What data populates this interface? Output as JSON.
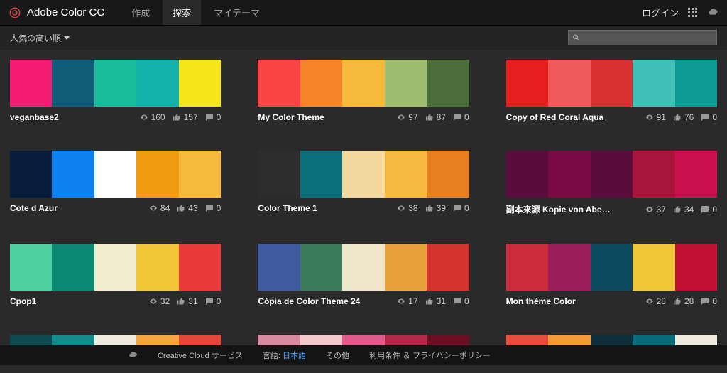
{
  "header": {
    "app_title": "Adobe Color CC",
    "tabs": [
      {
        "label": "作成"
      },
      {
        "label": "探索"
      },
      {
        "label": "マイテーマ"
      }
    ],
    "login": "ログイン"
  },
  "subbar": {
    "sort": "人気の高い順",
    "search_placeholder": ""
  },
  "themes": [
    {
      "name": "veganbase2",
      "views": "160",
      "likes": "157",
      "comments": "0",
      "colors": [
        "#f41b72",
        "#0f5b78",
        "#1abc9c",
        "#14b1aa",
        "#f5e51b"
      ]
    },
    {
      "name": "My Color Theme",
      "views": "97",
      "likes": "87",
      "comments": "0",
      "colors": [
        "#fa4444",
        "#f5842b",
        "#f6b93b",
        "#9fbd6e",
        "#4b6e3a"
      ]
    },
    {
      "name": "Copy of Red Coral Aqua",
      "views": "91",
      "likes": "76",
      "comments": "0",
      "colors": [
        "#e71e1e",
        "#ef5a5a",
        "#d93131",
        "#41c0b8",
        "#0e9a94"
      ]
    },
    {
      "name": "Cote d Azur",
      "views": "84",
      "likes": "43",
      "comments": "0",
      "colors": [
        "#071c3a",
        "#0d81f0",
        "#ffffff",
        "#f39c12",
        "#f6b93b"
      ]
    },
    {
      "name": "Color Theme 1",
      "views": "38",
      "likes": "39",
      "comments": "0",
      "colors": [
        "#2d2d2d",
        "#0b6e7a",
        "#f3d9a0",
        "#f5b942",
        "#e67e22"
      ]
    },
    {
      "name": "副本來源 Kopie von Aberd...",
      "views": "37",
      "likes": "34",
      "comments": "0",
      "colors": [
        "#5a0c3c",
        "#7a0a44",
        "#5a0c3c",
        "#a8153a",
        "#c8114e"
      ]
    },
    {
      "name": "Cpop1",
      "views": "32",
      "likes": "31",
      "comments": "0",
      "colors": [
        "#4ed1a1",
        "#0a8a72",
        "#f3eccf",
        "#f2c438",
        "#e83a3a"
      ]
    },
    {
      "name": "Cópia de Color Theme 24",
      "views": "17",
      "likes": "31",
      "comments": "0",
      "colors": [
        "#3f5a9e",
        "#3b7a5a",
        "#f0e6cc",
        "#e6a13a",
        "#d4342e"
      ]
    },
    {
      "name": "Mon thème Color",
      "views": "28",
      "likes": "28",
      "comments": "0",
      "colors": [
        "#cc2c3c",
        "#9c1f5a",
        "#0b4a5f",
        "#f2c438",
        "#c21033"
      ]
    },
    {
      "name": "",
      "views": "",
      "likes": "",
      "comments": "",
      "colors": [
        "#0f4a4f",
        "#128b8a",
        "#f0ede0",
        "#f4a640",
        "#e8463a"
      ]
    },
    {
      "name": "",
      "views": "",
      "likes": "",
      "comments": "",
      "colors": [
        "#d88ba0",
        "#f3c9cd",
        "#e05a8b",
        "#b32849",
        "#6b0f25"
      ]
    },
    {
      "name": "",
      "views": "",
      "likes": "",
      "comments": "",
      "colors": [
        "#e84c3d",
        "#f29b38",
        "#0e2f3a",
        "#0a6b7a",
        "#f0ede0"
      ]
    }
  ],
  "footer": {
    "cc": "Creative Cloud サービス",
    "lang_label": "言語:",
    "lang": "日本語",
    "other": "その他",
    "terms": "利用条件 ＆ プライバシーポリシー"
  }
}
